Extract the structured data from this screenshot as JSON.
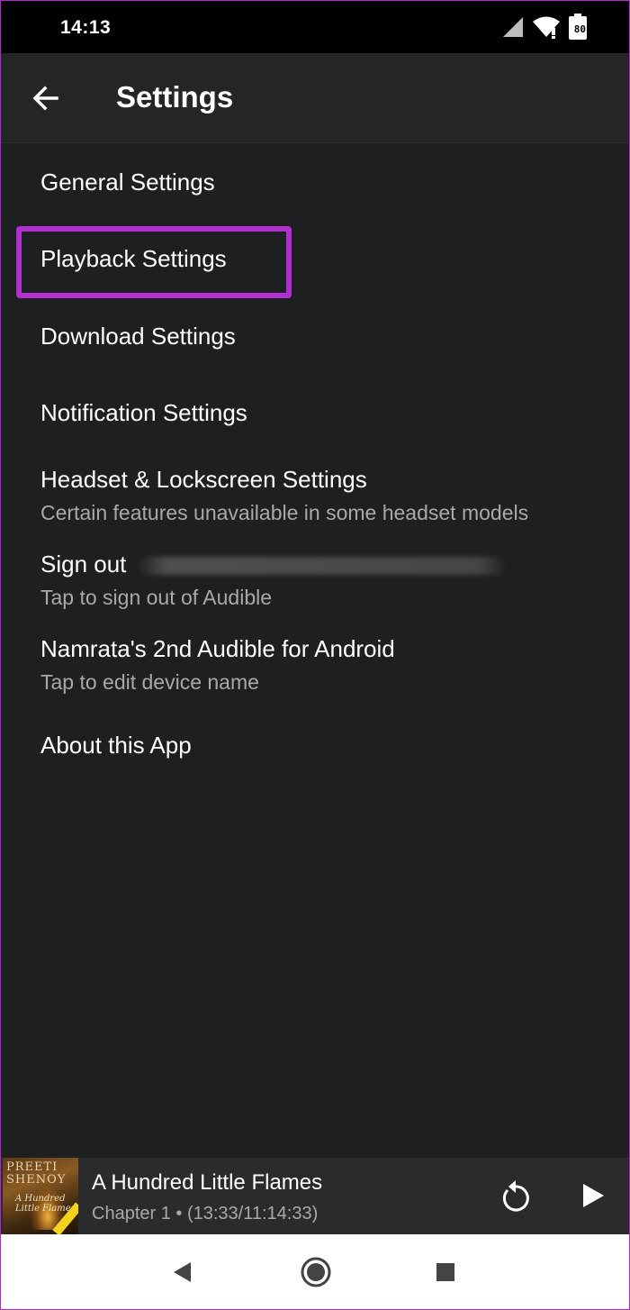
{
  "status_bar": {
    "time": "14:13",
    "battery_level": "80",
    "icons": [
      "signal-icon",
      "wifi-icon",
      "battery-icon"
    ]
  },
  "app_bar": {
    "title": "Settings",
    "back_icon": "arrow-left-icon"
  },
  "settings": {
    "items": [
      {
        "title": "General Settings"
      },
      {
        "title": "Playback Settings",
        "highlighted": true
      },
      {
        "title": "Download Settings"
      },
      {
        "title": "Notification Settings"
      },
      {
        "title": "Headset & Lockscreen Settings",
        "subtitle": "Certain features unavailable in some headset models"
      },
      {
        "title": "Sign out",
        "subtitle": "Tap to sign out of Audible"
      },
      {
        "title": "Namrata's 2nd Audible for Android",
        "subtitle": "Tap to edit device name"
      },
      {
        "title": "About this App"
      }
    ]
  },
  "player": {
    "cover_author": "PREETI SHENOY",
    "cover_title": "A Hundred Little Flames",
    "title": "A Hundred Little Flames",
    "subtitle": "Chapter 1 • (13:33/11:14:33)",
    "replay_icon": "replay-icon",
    "play_icon": "play-icon"
  },
  "colors": {
    "background": "#1e1f21",
    "app_bar": "#242527",
    "highlight": "#b12ed0",
    "secondary_text": "#a8a9ab"
  }
}
